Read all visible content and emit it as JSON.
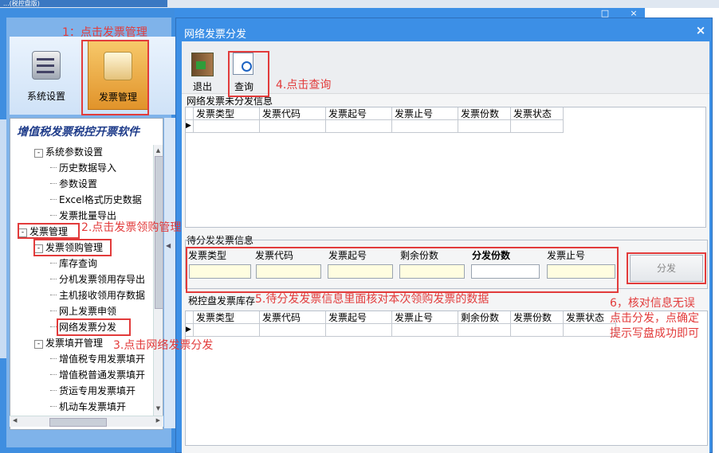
{
  "background_app": {
    "title_fragment": "...(税控盘版)"
  },
  "ribbon": {
    "system_settings": "系统设置",
    "invoice_management": "发票管理"
  },
  "tree": {
    "title": "增值税发票税控开票软件",
    "nodes": [
      {
        "label": "系统参数设置",
        "toggle": "-"
      },
      {
        "label": "历史数据导入"
      },
      {
        "label": "参数设置"
      },
      {
        "label": "Excel格式历史数据"
      },
      {
        "label": "发票批量导出"
      },
      {
        "label": "发票管理",
        "toggle": "-"
      },
      {
        "label": "发票领购管理",
        "toggle": "-"
      },
      {
        "label": "库存查询"
      },
      {
        "label": "分机发票领用存导出"
      },
      {
        "label": "主机接收领用存数据"
      },
      {
        "label": "网上发票申领"
      },
      {
        "label": "网络发票分发"
      },
      {
        "label": "发票填开管理",
        "toggle": "-"
      },
      {
        "label": "增值税专用发票填开"
      },
      {
        "label": "增值税普通发票填开"
      },
      {
        "label": "货运专用发票填开"
      },
      {
        "label": "机动车发票填开"
      }
    ]
  },
  "dialog": {
    "title": "网络发票分发",
    "close": "×",
    "toolbar": {
      "exit": "退出",
      "query": "查询"
    },
    "undistributed": {
      "title": "网络发票未分发信息",
      "columns": [
        "发票类型",
        "发票代码",
        "发票起号",
        "发票止号",
        "发票份数",
        "发票状态"
      ]
    },
    "pending": {
      "title": "待分发发票信息",
      "labels": {
        "type": "发票类型",
        "code": "发票代码",
        "start": "发票起号",
        "remaining": "剩余份数",
        "distribute_count": "分发份数",
        "end": "发票止号"
      },
      "button": "分发"
    },
    "inventory": {
      "title": "税控盘发票库存",
      "columns": [
        "发票类型",
        "发票代码",
        "发票起号",
        "发票止号",
        "剩余份数",
        "发票份数",
        "发票状态"
      ]
    }
  },
  "annotations": {
    "step1": "1：点击发票管理",
    "step2": "2.点击发票领购管理",
    "step3": "3.点击网络发票分发",
    "step4": "4.点击查询",
    "step5": "5.待分发发票信息里面核对本次领购发票的数据",
    "step6_line1": "6，核对信息无误",
    "step6_line2": "点击分发，点确定",
    "step6_line3": "提示写盘成功即可"
  },
  "colors": {
    "annotation_red": "#e23b3b",
    "dialog_blue": "#3c8fe6",
    "input_yellow": "#fffde0"
  }
}
